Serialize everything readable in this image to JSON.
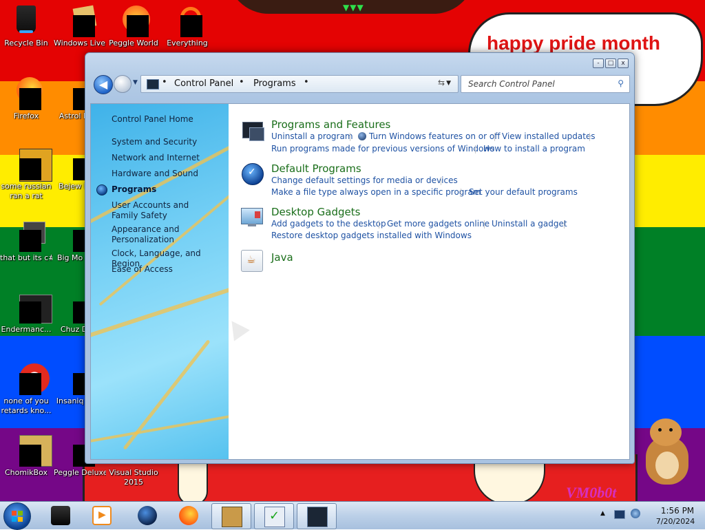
{
  "desktop": {
    "speech_text": "happy pride month",
    "watermark": "VM0b0t",
    "icons": [
      {
        "label": "Recycle Bin"
      },
      {
        "label": "Windows Live Ma..."
      },
      {
        "label": "Peggle World"
      },
      {
        "label": "Everything"
      },
      {
        "label": "Firefox"
      },
      {
        "label": "Astrol Delu"
      },
      {
        "label": "some russian ran a rat"
      },
      {
        "label": "Bejew Delu"
      },
      {
        "label": "that but its c#"
      },
      {
        "label": "Big Mo Delu"
      },
      {
        "label": "Endermanc..."
      },
      {
        "label": "Chuz Delu"
      },
      {
        "label": "none of you retards kno..."
      },
      {
        "label": "Insaniq Delu"
      },
      {
        "label": "ChomikBox"
      },
      {
        "label": "Peggle Deluxe"
      },
      {
        "label": "Visual Studio 2015"
      }
    ]
  },
  "window": {
    "caption_buttons": {
      "minimize": "-",
      "maximize": "□",
      "close": "x"
    },
    "address": {
      "crumbs": [
        "Control Panel",
        "Programs"
      ]
    },
    "search": {
      "placeholder": "Search Control Panel"
    },
    "sidebar": {
      "home": "Control Panel Home",
      "items": [
        "System and Security",
        "Network and Internet",
        "Hardware and Sound",
        "Programs",
        "User Accounts and Family Safety",
        "Appearance and Personalization",
        "Clock, Language, and Region",
        "Ease of Access"
      ]
    },
    "categories": [
      {
        "title": "Programs and Features",
        "links": [
          "Uninstall a program",
          "Turn Windows features on or off",
          "View installed updates",
          "Run programs made for previous versions of Windows",
          "How to install a program"
        ]
      },
      {
        "title": "Default Programs",
        "links": [
          "Change default settings for media or devices",
          "Make a file type always open in a specific program",
          "Set your default programs"
        ]
      },
      {
        "title": "Desktop Gadgets",
        "links": [
          "Add gadgets to the desktop",
          "Get more gadgets online",
          "Uninstall a gadget",
          "Restore desktop gadgets installed with Windows"
        ]
      },
      {
        "title": "Java",
        "links": []
      }
    ]
  },
  "taskbar": {
    "items": [
      "speaker-app",
      "media-player",
      "globe-app",
      "firefox",
      "chomikbox",
      "checklist-app",
      "control-panel"
    ],
    "clock": {
      "time": "1:56 PM",
      "date": "7/20/2024"
    }
  },
  "colors": {
    "link": "#1f52a3",
    "category_title": "#1a6e1a",
    "speech_text": "#e01414",
    "watermark": "#d62fbe"
  }
}
